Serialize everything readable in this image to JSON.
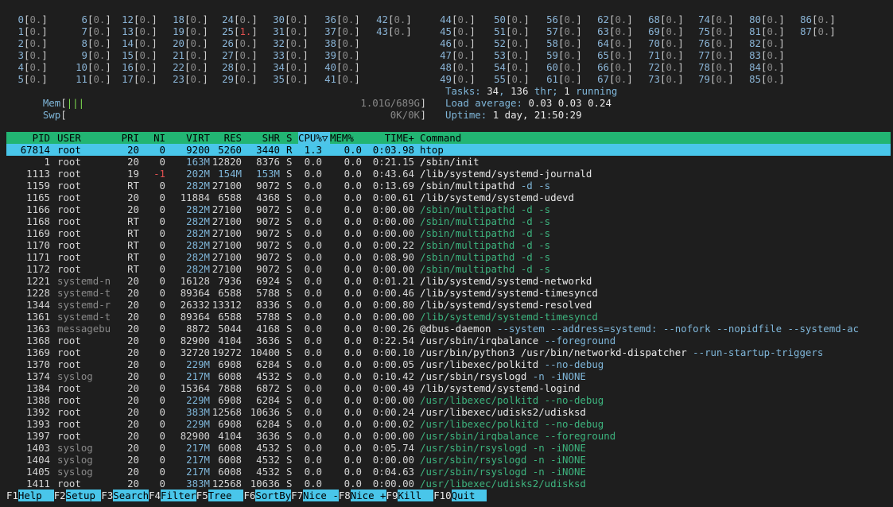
{
  "cpu_columns": [
    {
      "cores": [
        {
          "n": "0",
          "v": "0."
        },
        {
          "n": "1",
          "v": "0."
        },
        {
          "n": "2",
          "v": "0."
        },
        {
          "n": "3",
          "v": "0."
        },
        {
          "n": "4",
          "v": "0."
        },
        {
          "n": "5",
          "v": "0."
        }
      ]
    },
    {
      "cores": [
        {
          "n": "6",
          "v": "0."
        },
        {
          "n": "7",
          "v": "0."
        },
        {
          "n": "8",
          "v": "0."
        },
        {
          "n": "9",
          "v": "0."
        },
        {
          "n": "10",
          "v": "0."
        },
        {
          "n": "11",
          "v": "0."
        }
      ]
    },
    {
      "cores": [
        {
          "n": "12",
          "v": "0."
        },
        {
          "n": "13",
          "v": "0."
        },
        {
          "n": "14",
          "v": "0."
        },
        {
          "n": "15",
          "v": "0."
        },
        {
          "n": "16",
          "v": "0."
        },
        {
          "n": "17",
          "v": "0."
        }
      ]
    },
    {
      "cores": [
        {
          "n": "18",
          "v": "0."
        },
        {
          "n": "19",
          "v": "0."
        },
        {
          "n": "20",
          "v": "0."
        },
        {
          "n": "21",
          "v": "0."
        },
        {
          "n": "22",
          "v": "0."
        },
        {
          "n": "23",
          "v": "0."
        }
      ]
    },
    {
      "cores": [
        {
          "n": "24",
          "v": "0."
        },
        {
          "n": "25",
          "v": "1."
        },
        {
          "n": "26",
          "v": "0."
        },
        {
          "n": "27",
          "v": "0."
        },
        {
          "n": "28",
          "v": "0."
        },
        {
          "n": "29",
          "v": "0."
        }
      ]
    },
    {
      "cores": [
        {
          "n": "30",
          "v": "0."
        },
        {
          "n": "31",
          "v": "0."
        },
        {
          "n": "32",
          "v": "0."
        },
        {
          "n": "33",
          "v": "0."
        },
        {
          "n": "34",
          "v": "0."
        },
        {
          "n": "35",
          "v": "0."
        }
      ]
    },
    {
      "cores": [
        {
          "n": "36",
          "v": "0."
        },
        {
          "n": "37",
          "v": "0."
        },
        {
          "n": "38",
          "v": "0."
        },
        {
          "n": "39",
          "v": "0."
        },
        {
          "n": "40",
          "v": "0."
        },
        {
          "n": "41",
          "v": "0."
        }
      ]
    },
    {
      "cores": [
        {
          "n": "42",
          "v": "0."
        },
        {
          "n": "43",
          "v": "0."
        }
      ]
    },
    {
      "cores": [
        {
          "n": "44",
          "v": "0."
        },
        {
          "n": "45",
          "v": "0."
        },
        {
          "n": "46",
          "v": "0."
        },
        {
          "n": "47",
          "v": "0."
        },
        {
          "n": "48",
          "v": "0."
        },
        {
          "n": "49",
          "v": "0."
        }
      ]
    },
    {
      "cores": [
        {
          "n": "50",
          "v": "0."
        },
        {
          "n": "51",
          "v": "0."
        },
        {
          "n": "52",
          "v": "0."
        },
        {
          "n": "53",
          "v": "0."
        },
        {
          "n": "54",
          "v": "0."
        },
        {
          "n": "55",
          "v": "0."
        }
      ]
    },
    {
      "cores": [
        {
          "n": "56",
          "v": "0."
        },
        {
          "n": "57",
          "v": "0."
        },
        {
          "n": "58",
          "v": "0."
        },
        {
          "n": "59",
          "v": "0."
        },
        {
          "n": "60",
          "v": "0."
        },
        {
          "n": "61",
          "v": "0."
        }
      ]
    },
    {
      "cores": [
        {
          "n": "62",
          "v": "0."
        },
        {
          "n": "63",
          "v": "0."
        },
        {
          "n": "64",
          "v": "0."
        },
        {
          "n": "65",
          "v": "0."
        },
        {
          "n": "66",
          "v": "0."
        },
        {
          "n": "67",
          "v": "0."
        }
      ]
    },
    {
      "cores": [
        {
          "n": "68",
          "v": "0."
        },
        {
          "n": "69",
          "v": "0."
        },
        {
          "n": "70",
          "v": "0."
        },
        {
          "n": "71",
          "v": "0."
        },
        {
          "n": "72",
          "v": "0."
        },
        {
          "n": "73",
          "v": "0."
        }
      ]
    },
    {
      "cores": [
        {
          "n": "74",
          "v": "0."
        },
        {
          "n": "75",
          "v": "0."
        },
        {
          "n": "76",
          "v": "0."
        },
        {
          "n": "77",
          "v": "0."
        },
        {
          "n": "78",
          "v": "0."
        },
        {
          "n": "79",
          "v": "0."
        }
      ]
    },
    {
      "cores": [
        {
          "n": "80",
          "v": "0."
        },
        {
          "n": "81",
          "v": "0."
        },
        {
          "n": "82",
          "v": "0."
        },
        {
          "n": "83",
          "v": "0."
        },
        {
          "n": "84",
          "v": "0."
        },
        {
          "n": "85",
          "v": "0."
        }
      ]
    },
    {
      "cores": [
        {
          "n": "86",
          "v": "0."
        },
        {
          "n": "87",
          "v": "0."
        }
      ]
    }
  ],
  "mem": {
    "label": "Mem",
    "bar": "|||",
    "value": "1.01G/689G"
  },
  "swp": {
    "label": "Swp",
    "bar": "",
    "value": "0K/0K"
  },
  "tasks": {
    "label": "Tasks: ",
    "count": "34",
    "sep1": ", ",
    "thr": "136",
    "thr_label": " thr; ",
    "running": "1",
    "running_label": " running"
  },
  "load": {
    "label": "Load average: ",
    "l1": "0.03",
    "l5": "0.03",
    "l15": "0.24"
  },
  "uptime": {
    "label": "Uptime: ",
    "value": "1 day, 21:50:29"
  },
  "columns": {
    "pid": "PID",
    "user": "USER",
    "pri": "PRI",
    "ni": "NI",
    "virt": "VIRT",
    "res": "RES",
    "shr": "SHR",
    "s": "S",
    "cpu": "CPU%▽",
    "mem": "MEM%",
    "time": "TIME+",
    "cmd": "Command"
  },
  "processes": [
    {
      "pid": "67814",
      "user": "root",
      "pri": "20",
      "ni": "0",
      "virt": "9200",
      "res": "5260",
      "shr": "3440",
      "s": "R",
      "cpu": "1.3",
      "mem": "0.0",
      "time": "0:03.98",
      "cmd": "htop",
      "args": "",
      "thread": false,
      "selected": true
    },
    {
      "pid": "1",
      "user": "root",
      "pri": "20",
      "ni": "0",
      "virt": "163M",
      "res": "12820",
      "shr": "8376",
      "s": "S",
      "cpu": "0.0",
      "mem": "0.0",
      "time": "0:21.15",
      "cmd": "/sbin/init",
      "args": "",
      "thread": false
    },
    {
      "pid": "1113",
      "user": "root",
      "pri": "19",
      "ni": "-1",
      "virt": "202M",
      "res": "154M",
      "shr": "153M",
      "s": "S",
      "cpu": "0.0",
      "mem": "0.0",
      "time": "0:43.64",
      "cmd": "/lib/systemd/systemd-journald",
      "args": "",
      "thread": false
    },
    {
      "pid": "1159",
      "user": "root",
      "pri": "RT",
      "ni": "0",
      "virt": "282M",
      "res": "27100",
      "shr": "9072",
      "s": "S",
      "cpu": "0.0",
      "mem": "0.0",
      "time": "0:13.69",
      "cmd": "/sbin/multipathd",
      "args": " -d -s",
      "thread": false
    },
    {
      "pid": "1165",
      "user": "root",
      "pri": "20",
      "ni": "0",
      "virt": "11884",
      "res": "6588",
      "shr": "4368",
      "s": "S",
      "cpu": "0.0",
      "mem": "0.0",
      "time": "0:00.61",
      "cmd": "/lib/systemd/systemd-udevd",
      "args": "",
      "thread": false
    },
    {
      "pid": "1166",
      "user": "root",
      "pri": "20",
      "ni": "0",
      "virt": "282M",
      "res": "27100",
      "shr": "9072",
      "s": "S",
      "cpu": "0.0",
      "mem": "0.0",
      "time": "0:00.00",
      "cmd": "/sbin/multipathd",
      "args": " -d -s",
      "thread": true
    },
    {
      "pid": "1168",
      "user": "root",
      "pri": "RT",
      "ni": "0",
      "virt": "282M",
      "res": "27100",
      "shr": "9072",
      "s": "S",
      "cpu": "0.0",
      "mem": "0.0",
      "time": "0:00.00",
      "cmd": "/sbin/multipathd",
      "args": " -d -s",
      "thread": true
    },
    {
      "pid": "1169",
      "user": "root",
      "pri": "RT",
      "ni": "0",
      "virt": "282M",
      "res": "27100",
      "shr": "9072",
      "s": "S",
      "cpu": "0.0",
      "mem": "0.0",
      "time": "0:00.00",
      "cmd": "/sbin/multipathd",
      "args": " -d -s",
      "thread": true
    },
    {
      "pid": "1170",
      "user": "root",
      "pri": "RT",
      "ni": "0",
      "virt": "282M",
      "res": "27100",
      "shr": "9072",
      "s": "S",
      "cpu": "0.0",
      "mem": "0.0",
      "time": "0:00.22",
      "cmd": "/sbin/multipathd",
      "args": " -d -s",
      "thread": true
    },
    {
      "pid": "1171",
      "user": "root",
      "pri": "RT",
      "ni": "0",
      "virt": "282M",
      "res": "27100",
      "shr": "9072",
      "s": "S",
      "cpu": "0.0",
      "mem": "0.0",
      "time": "0:08.90",
      "cmd": "/sbin/multipathd",
      "args": " -d -s",
      "thread": true
    },
    {
      "pid": "1172",
      "user": "root",
      "pri": "RT",
      "ni": "0",
      "virt": "282M",
      "res": "27100",
      "shr": "9072",
      "s": "S",
      "cpu": "0.0",
      "mem": "0.0",
      "time": "0:00.00",
      "cmd": "/sbin/multipathd",
      "args": " -d -s",
      "thread": true
    },
    {
      "pid": "1221",
      "user": "systemd-n",
      "pri": "20",
      "ni": "0",
      "virt": "16128",
      "res": "7936",
      "shr": "6924",
      "s": "S",
      "cpu": "0.0",
      "mem": "0.0",
      "time": "0:01.21",
      "cmd": "/lib/systemd/systemd-networkd",
      "args": "",
      "thread": false
    },
    {
      "pid": "1228",
      "user": "systemd-t",
      "pri": "20",
      "ni": "0",
      "virt": "89364",
      "res": "6588",
      "shr": "5788",
      "s": "S",
      "cpu": "0.0",
      "mem": "0.0",
      "time": "0:00.46",
      "cmd": "/lib/systemd/systemd-timesyncd",
      "args": "",
      "thread": false
    },
    {
      "pid": "1344",
      "user": "systemd-r",
      "pri": "20",
      "ni": "0",
      "virt": "26332",
      "res": "13312",
      "shr": "8336",
      "s": "S",
      "cpu": "0.0",
      "mem": "0.0",
      "time": "0:00.80",
      "cmd": "/lib/systemd/systemd-resolved",
      "args": "",
      "thread": false
    },
    {
      "pid": "1361",
      "user": "systemd-t",
      "pri": "20",
      "ni": "0",
      "virt": "89364",
      "res": "6588",
      "shr": "5788",
      "s": "S",
      "cpu": "0.0",
      "mem": "0.0",
      "time": "0:00.00",
      "cmd": "/lib/systemd/systemd-timesyncd",
      "args": "",
      "thread": true
    },
    {
      "pid": "1363",
      "user": "messagebu",
      "pri": "20",
      "ni": "0",
      "virt": "8872",
      "res": "5044",
      "shr": "4168",
      "s": "S",
      "cpu": "0.0",
      "mem": "0.0",
      "time": "0:00.26",
      "cmd": "@dbus-daemon",
      "args": " --system --address=systemd: --nofork --nopidfile --systemd-ac",
      "thread": false
    },
    {
      "pid": "1368",
      "user": "root",
      "pri": "20",
      "ni": "0",
      "virt": "82900",
      "res": "4104",
      "shr": "3636",
      "s": "S",
      "cpu": "0.0",
      "mem": "0.0",
      "time": "0:22.54",
      "cmd": "/usr/sbin/irqbalance",
      "args": " --foreground",
      "thread": false
    },
    {
      "pid": "1369",
      "user": "root",
      "pri": "20",
      "ni": "0",
      "virt": "32720",
      "res": "19272",
      "shr": "10400",
      "s": "S",
      "cpu": "0.0",
      "mem": "0.0",
      "time": "0:00.10",
      "cmd": "/usr/bin/python3 /usr/bin/networkd-dispatcher",
      "args": " --run-startup-triggers",
      "thread": false
    },
    {
      "pid": "1370",
      "user": "root",
      "pri": "20",
      "ni": "0",
      "virt": "229M",
      "res": "6908",
      "shr": "6284",
      "s": "S",
      "cpu": "0.0",
      "mem": "0.0",
      "time": "0:00.05",
      "cmd": "/usr/libexec/polkitd",
      "args": " --no-debug",
      "thread": false
    },
    {
      "pid": "1374",
      "user": "syslog",
      "pri": "20",
      "ni": "0",
      "virt": "217M",
      "res": "6008",
      "shr": "4532",
      "s": "S",
      "cpu": "0.0",
      "mem": "0.0",
      "time": "0:10.42",
      "cmd": "/usr/sbin/rsyslogd",
      "args": " -n -iNONE",
      "thread": false
    },
    {
      "pid": "1384",
      "user": "root",
      "pri": "20",
      "ni": "0",
      "virt": "15364",
      "res": "7888",
      "shr": "6872",
      "s": "S",
      "cpu": "0.0",
      "mem": "0.0",
      "time": "0:00.49",
      "cmd": "/lib/systemd/systemd-logind",
      "args": "",
      "thread": false
    },
    {
      "pid": "1388",
      "user": "root",
      "pri": "20",
      "ni": "0",
      "virt": "229M",
      "res": "6908",
      "shr": "6284",
      "s": "S",
      "cpu": "0.0",
      "mem": "0.0",
      "time": "0:00.00",
      "cmd": "/usr/libexec/polkitd",
      "args": " --no-debug",
      "thread": true
    },
    {
      "pid": "1392",
      "user": "root",
      "pri": "20",
      "ni": "0",
      "virt": "383M",
      "res": "12568",
      "shr": "10636",
      "s": "S",
      "cpu": "0.0",
      "mem": "0.0",
      "time": "0:00.24",
      "cmd": "/usr/libexec/udisks2/udisksd",
      "args": "",
      "thread": false
    },
    {
      "pid": "1393",
      "user": "root",
      "pri": "20",
      "ni": "0",
      "virt": "229M",
      "res": "6908",
      "shr": "6284",
      "s": "S",
      "cpu": "0.0",
      "mem": "0.0",
      "time": "0:00.02",
      "cmd": "/usr/libexec/polkitd",
      "args": " --no-debug",
      "thread": true
    },
    {
      "pid": "1397",
      "user": "root",
      "pri": "20",
      "ni": "0",
      "virt": "82900",
      "res": "4104",
      "shr": "3636",
      "s": "S",
      "cpu": "0.0",
      "mem": "0.0",
      "time": "0:00.00",
      "cmd": "/usr/sbin/irqbalance",
      "args": " --foreground",
      "thread": true
    },
    {
      "pid": "1403",
      "user": "syslog",
      "pri": "20",
      "ni": "0",
      "virt": "217M",
      "res": "6008",
      "shr": "4532",
      "s": "S",
      "cpu": "0.0",
      "mem": "0.0",
      "time": "0:05.74",
      "cmd": "/usr/sbin/rsyslogd",
      "args": " -n -iNONE",
      "thread": true
    },
    {
      "pid": "1404",
      "user": "syslog",
      "pri": "20",
      "ni": "0",
      "virt": "217M",
      "res": "6008",
      "shr": "4532",
      "s": "S",
      "cpu": "0.0",
      "mem": "0.0",
      "time": "0:00.00",
      "cmd": "/usr/sbin/rsyslogd",
      "args": " -n -iNONE",
      "thread": true
    },
    {
      "pid": "1405",
      "user": "syslog",
      "pri": "20",
      "ni": "0",
      "virt": "217M",
      "res": "6008",
      "shr": "4532",
      "s": "S",
      "cpu": "0.0",
      "mem": "0.0",
      "time": "0:04.63",
      "cmd": "/usr/sbin/rsyslogd",
      "args": " -n -iNONE",
      "thread": true
    },
    {
      "pid": "1411",
      "user": "root",
      "pri": "20",
      "ni": "0",
      "virt": "383M",
      "res": "12568",
      "shr": "10636",
      "s": "S",
      "cpu": "0.0",
      "mem": "0.0",
      "time": "0:00.00",
      "cmd": "/usr/libexec/udisks2/udisksd",
      "args": "",
      "thread": true
    }
  ],
  "footer": [
    {
      "key": "F1",
      "label": "Help  "
    },
    {
      "key": "F2",
      "label": "Setup "
    },
    {
      "key": "F3",
      "label": "Search"
    },
    {
      "key": "F4",
      "label": "Filter"
    },
    {
      "key": "F5",
      "label": "Tree  "
    },
    {
      "key": "F6",
      "label": "SortBy"
    },
    {
      "key": "F7",
      "label": "Nice -"
    },
    {
      "key": "F8",
      "label": "Nice +"
    },
    {
      "key": "F9",
      "label": "Kill  "
    },
    {
      "key": "F10",
      "label": "Quit  "
    }
  ]
}
